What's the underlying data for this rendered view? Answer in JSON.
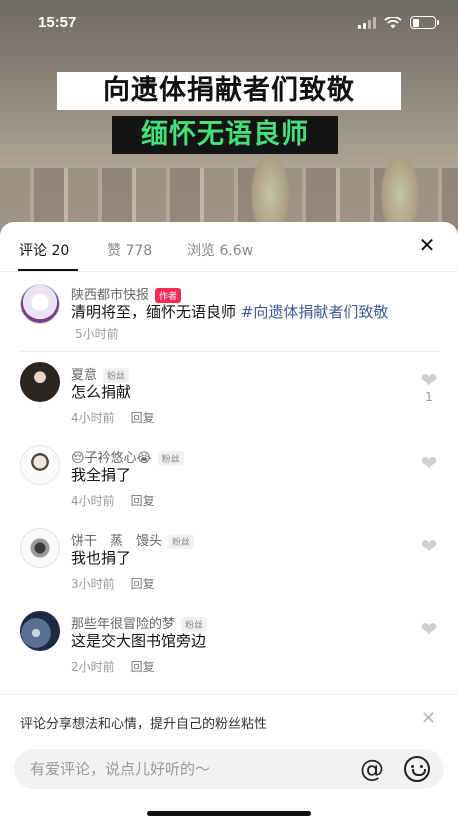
{
  "status_bar": {
    "time": "15:57"
  },
  "video": {
    "caption_line1": "向遗体捐献者们致敬",
    "caption_line2": "缅怀无语良师"
  },
  "tabs": [
    {
      "label": "评论 20",
      "active": true
    },
    {
      "label": "赞 778",
      "active": false
    },
    {
      "label": "浏览 6.6w",
      "active": false
    }
  ],
  "author_post": {
    "name": "陕西都市快报",
    "badge": "作者",
    "text": "清明将至，缅怀无语良师 ",
    "hashtag": "#向遗体捐献者们致敬",
    "time": "5小时前"
  },
  "comments": [
    {
      "name": "夏意",
      "badge": "粉丝",
      "text": "怎么捐献",
      "time": "4小时前",
      "reply": "回复",
      "likes": "1"
    },
    {
      "name": "😔子衿悠心😭",
      "badge": "粉丝",
      "text": "我全捐了",
      "time": "4小时前",
      "reply": "回复",
      "likes": ""
    },
    {
      "name": "饼干　蒸　馒头",
      "badge": "粉丝",
      "text": "我也捐了",
      "time": "3小时前",
      "reply": "回复",
      "likes": ""
    },
    {
      "name": "那些年很冒险的梦",
      "badge": "粉丝",
      "text": "这是交大图书馆旁边",
      "time": "2小时前",
      "reply": "回复",
      "likes": ""
    }
  ],
  "bottom_bar": {
    "tip": "评论分享想法和心情，提升自己的粉丝粘性",
    "input_placeholder": "有爱评论，说点儿好听的～"
  },
  "colors": {
    "accent_red": "#fe2c55",
    "hashtag_blue": "#3b5b95",
    "caption_green": "#45e07a"
  },
  "icons": [
    "signal-icon",
    "wifi-icon",
    "battery-icon",
    "close-icon",
    "heart-icon",
    "at-icon",
    "emoji-icon"
  ]
}
